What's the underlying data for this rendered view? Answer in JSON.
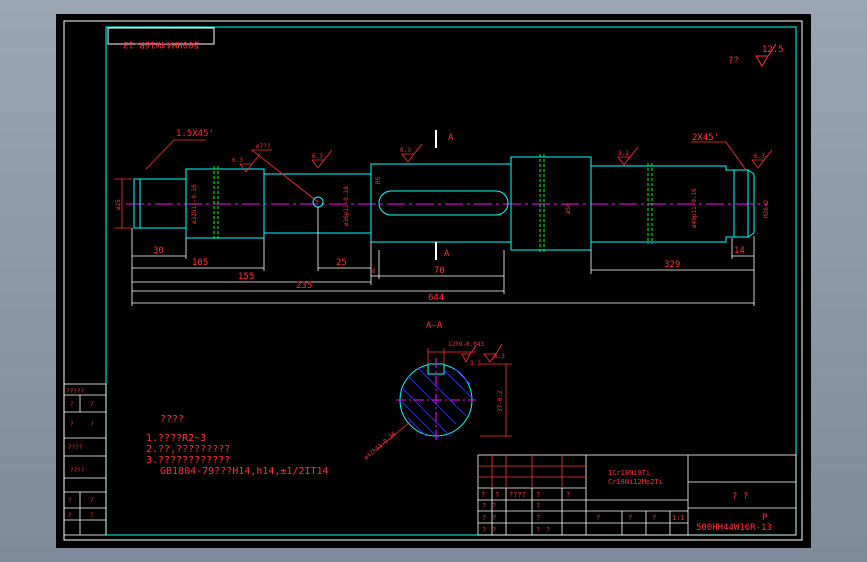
{
  "drawing": {
    "code_top": "500HH44W16R-13",
    "surface_finish_general": "12.5",
    "surface_finish_prefix": "??",
    "section_marker": "A",
    "section_title": "A—A"
  },
  "dimensions": {
    "chamfer_left": "1.5X45'",
    "chamfer_right": "2X45'",
    "roughness_1": "6.3",
    "roughness_2": "6.3",
    "roughness_3": "6.3",
    "roughness_4": "3.2",
    "roughness_5": "6.3",
    "roughness_6": "3.2",
    "roughness_7": "6.3",
    "dia_hole": "ø7??",
    "dia_25": "ø25",
    "dia_32": "ø32h11-0.16",
    "dia_36": "ø36p11-0.18",
    "dia_50": "ø50",
    "dia_40": "ø40p11-0.16",
    "thread": "M36×2",
    "r15": "R5",
    "len_30": "30",
    "len_105": "105",
    "len_155": "155",
    "len_25": "25",
    "len_8": "8",
    "len_70": "70",
    "len_235": "235",
    "len_644": "644",
    "len_14": "14",
    "len_329": "329",
    "key_width": "12h9-0.043",
    "key_depth": "37-0.2",
    "section_dia": "ø42h11-0.16"
  },
  "notes": {
    "title": "????",
    "line1": "1.????R2~3",
    "line2": "2.??,?????????",
    "line3": "3.????????????",
    "line4": "GB1804-79???H14,h14,±1/2IT14"
  },
  "side_table": {
    "r1": "?????",
    "r2a": "?",
    "r2b": "?",
    "r3": "????",
    "r4a": "?",
    "r4b": "?",
    "r5": "????",
    "r6a": "?",
    "r6b": "?",
    "r7a": "?",
    "r7b": "?"
  },
  "title_block": {
    "material": "1Cr18Ni9Ti",
    "material2": "Cr18Ni12Mo2Ti",
    "name": "? ?",
    "ratio": "1:1",
    "letter": "P",
    "code": "500HH44W16R-13",
    "h1": "?",
    "h2": "?",
    "h3": "????",
    "h4": "?",
    "h5": "?",
    "q": "?",
    "a1": "?",
    "a2": "?",
    "a3": "?",
    "a4": "?",
    "a5": "?",
    "a6": "?"
  }
}
